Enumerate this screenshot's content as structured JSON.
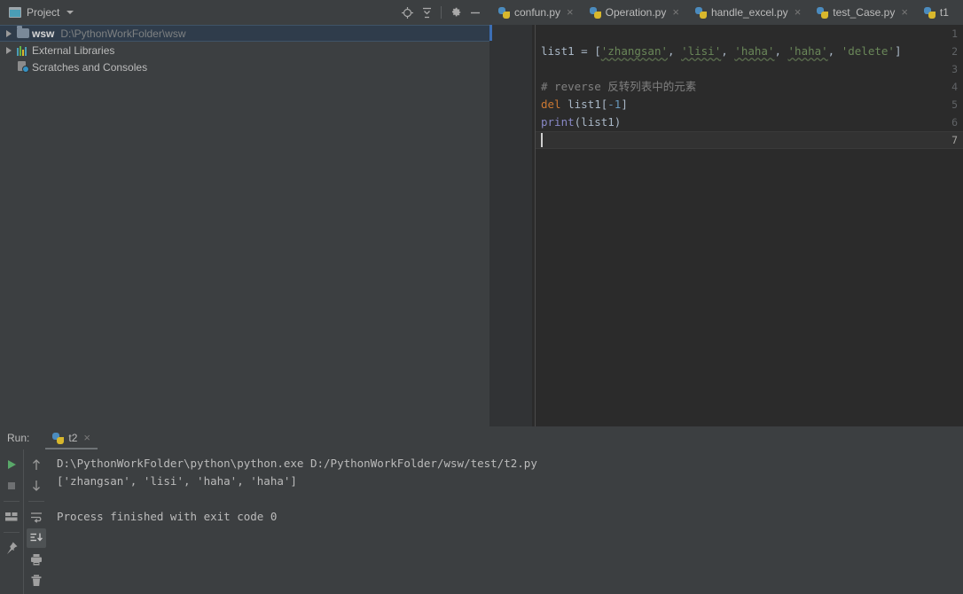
{
  "project_pane": {
    "title": "Project",
    "title_icon": "project-window-icon",
    "dropdown_icon": "chevron-down-icon",
    "actions": [
      {
        "name": "locate-icon",
        "glyph": "target"
      },
      {
        "name": "collapse-all-icon",
        "glyph": "collapse"
      },
      {
        "name": "gear-icon",
        "glyph": "gear"
      },
      {
        "name": "minimize-icon",
        "glyph": "minus"
      }
    ],
    "tree": [
      {
        "name": "wsw",
        "path": "D:\\PythonWorkFolder\\wsw",
        "icon": "folder-icon",
        "selected": true,
        "expandable": true
      },
      {
        "name": "External Libraries",
        "path": "",
        "icon": "library-icon",
        "selected": false,
        "expandable": true
      },
      {
        "name": "Scratches and Consoles",
        "path": "",
        "icon": "scratches-icon",
        "selected": false,
        "expandable": false
      }
    ]
  },
  "editor": {
    "tabs": [
      {
        "label": "confun.py",
        "icon": "python-file-icon",
        "close": "×"
      },
      {
        "label": "Operation.py",
        "icon": "python-file-icon",
        "close": "×"
      },
      {
        "label": "handle_excel.py",
        "icon": "python-file-icon",
        "close": "×"
      },
      {
        "label": "test_Case.py",
        "icon": "python-file-icon",
        "close": "×"
      },
      {
        "label": "t1",
        "icon": "python-file-icon",
        "close": ""
      }
    ],
    "line_numbers": [
      "1",
      "2",
      "3",
      "4",
      "5",
      "6",
      "7"
    ],
    "active_line": 7,
    "lines": [
      {
        "n": 1,
        "text": ""
      },
      {
        "n": 2,
        "text": "list1 = ['zhangsan', 'lisi', 'haha', 'haha', 'delete']"
      },
      {
        "n": 3,
        "text": ""
      },
      {
        "n": 4,
        "text": "# reverse 反转列表中的元素"
      },
      {
        "n": 5,
        "text": "del list1[-1]"
      },
      {
        "n": 6,
        "text": "print(list1)"
      },
      {
        "n": 7,
        "text": ""
      }
    ],
    "tokens": {
      "l2": {
        "var": "list1",
        "eq": " = [",
        "s1": "'zhangsan'",
        "c1": ", ",
        "s2": "'lisi'",
        "c2": ", ",
        "s3": "'haha'",
        "c3": ", ",
        "s4": "'haha'",
        "c4": ", ",
        "s5": "'delete'",
        "end": "]"
      },
      "l4": {
        "comment": "# reverse 反转列表中的元素"
      },
      "l5": {
        "kw": "del",
        "var": " list1[",
        "num": "-1",
        "end": "]"
      },
      "l6": {
        "fn": "print",
        "args": "(list1)"
      }
    },
    "colors": {
      "background": "#2B2B2B",
      "gutter": "#313335",
      "string": "#6A8759",
      "keyword": "#CC7832",
      "number": "#6897BB",
      "function": "#8888C6",
      "comment": "#808080",
      "default_text": "#A9B7C6",
      "current_line": "#323232"
    }
  },
  "run_panel": {
    "label": "Run:",
    "tab": {
      "label": "t2",
      "icon": "python-file-icon",
      "close": "×"
    },
    "toolbar_left": [
      {
        "name": "rerun-button",
        "glyph": "play",
        "color": "#59A869"
      },
      {
        "name": "stop-button",
        "glyph": "square",
        "color": "#6E7072"
      },
      {
        "name": "restore-layout-button",
        "glyph": "layout"
      },
      {
        "name": "pin-tab-button",
        "glyph": "pin"
      }
    ],
    "toolbar_right": [
      {
        "name": "up-arrow-button",
        "glyph": "arrow-up"
      },
      {
        "name": "down-arrow-button",
        "glyph": "arrow-down"
      },
      {
        "name": "soft-wrap-button",
        "glyph": "wrap"
      },
      {
        "name": "scroll-to-end-button",
        "glyph": "scroll-end",
        "active": true
      },
      {
        "name": "print-button",
        "glyph": "printer"
      },
      {
        "name": "clear-all-button",
        "glyph": "trash"
      }
    ],
    "console_lines": [
      "D:\\PythonWorkFolder\\python\\python.exe D:/PythonWorkFolder/wsw/test/t2.py",
      "['zhangsan', 'lisi', 'haha', 'haha']",
      "",
      "Process finished with exit code 0"
    ]
  }
}
